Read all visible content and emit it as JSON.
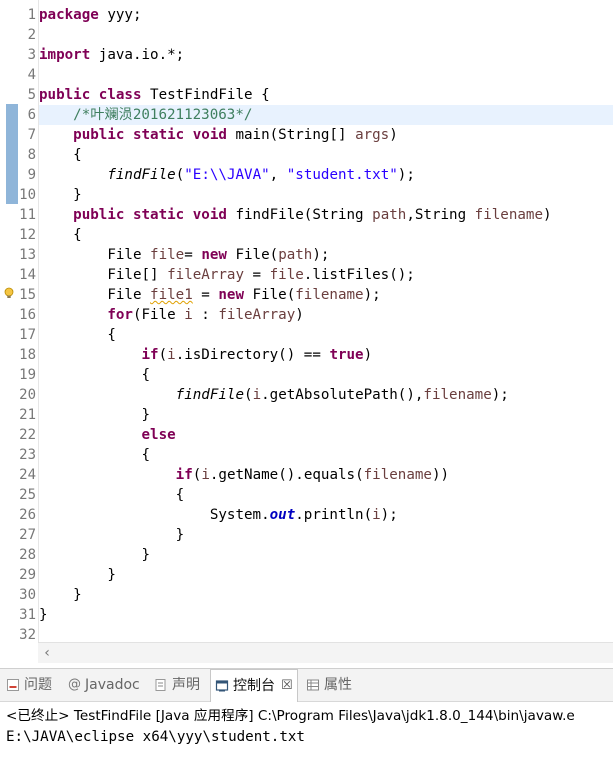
{
  "editor": {
    "line_numbers": [
      "1",
      "2",
      "3",
      "4",
      "5",
      "6",
      "7",
      "8",
      "9",
      "10",
      "11",
      "12",
      "13",
      "14",
      "15",
      "16",
      "17",
      "18",
      "19",
      "20",
      "21",
      "22",
      "23",
      "24",
      "25",
      "26",
      "27",
      "28",
      "29",
      "30",
      "31",
      "32"
    ],
    "lines": {
      "l1": [
        "package",
        " yyy;"
      ],
      "l3": [
        "import",
        " java.io.*;"
      ],
      "l5": [
        "public",
        " ",
        "class",
        " TestFindFile {"
      ],
      "l6": [
        "    ",
        "/*叶斓涢201621123063*/"
      ],
      "l7": [
        "    ",
        "public",
        " ",
        "static",
        " ",
        "void",
        " main(String[] ",
        "args",
        ")"
      ],
      "l8": [
        "    {"
      ],
      "l9": [
        "        ",
        "findFile",
        "(",
        "\"E:\\\\JAVA\"",
        ", ",
        "\"student.txt\"",
        ");"
      ],
      "l10": [
        "    }"
      ],
      "l11": [
        "    ",
        "public",
        " ",
        "static",
        " ",
        "void",
        " findFile(String ",
        "path",
        ",String ",
        "filename",
        ")"
      ],
      "l12": [
        "    {"
      ],
      "l13": [
        "        File ",
        "file",
        "= ",
        "new",
        " File(",
        "path",
        ");"
      ],
      "l14": [
        "        File[] ",
        "fileArray",
        " = ",
        "file",
        ".listFiles();"
      ],
      "l15": [
        "        File ",
        "file1",
        " = ",
        "new",
        " File(",
        "filename",
        ");"
      ],
      "l16": [
        "        ",
        "for",
        "(File ",
        "i",
        " : ",
        "fileArray",
        ")"
      ],
      "l17": [
        "        {"
      ],
      "l18": [
        "            ",
        "if",
        "(",
        "i",
        ".isDirectory() == ",
        "true",
        ")"
      ],
      "l19": [
        "            {"
      ],
      "l20": [
        "                ",
        "findFile",
        "(",
        "i",
        ".getAbsolutePath(),",
        "filename",
        ");"
      ],
      "l21": [
        "            }"
      ],
      "l22": [
        "            ",
        "else"
      ],
      "l23": [
        "            {"
      ],
      "l24": [
        "                ",
        "if",
        "(",
        "i",
        ".getName().equals(",
        "filename",
        "))"
      ],
      "l25": [
        "                {"
      ],
      "l26": [
        "                    System.",
        "out",
        ".println(",
        "i",
        ");"
      ],
      "l27": [
        "                }"
      ],
      "l28": [
        "            }"
      ],
      "l29": [
        "        }"
      ],
      "l30": [
        "    }"
      ],
      "l31": [
        "}"
      ]
    }
  },
  "colors": {
    "keyword": "#7f0055",
    "comment": "#3f7f5f",
    "string": "#2a00ff",
    "variable": "#6a3e3e",
    "field": "#0000c0",
    "current_line": "#e8f2fe",
    "gutter_marker": "#8fb5d9"
  },
  "panel": {
    "tabs": [
      {
        "label": "问题",
        "icon": "problems-icon"
      },
      {
        "label": "Javadoc",
        "icon": "javadoc-icon"
      },
      {
        "label": "声明",
        "icon": "declaration-icon"
      },
      {
        "label": "控制台",
        "icon": "console-icon",
        "active": true
      },
      {
        "label": "属性",
        "icon": "properties-icon"
      }
    ],
    "close_glyph": "☒",
    "terminated_line": "<已终止> TestFindFile [Java 应用程序] C:\\Program Files\\Java\\jdk1.8.0_144\\bin\\javaw.e",
    "output_line": "E:\\JAVA\\eclipse x64\\yyy\\student.txt"
  },
  "scrollbar": {
    "left_arrow": "‹"
  }
}
